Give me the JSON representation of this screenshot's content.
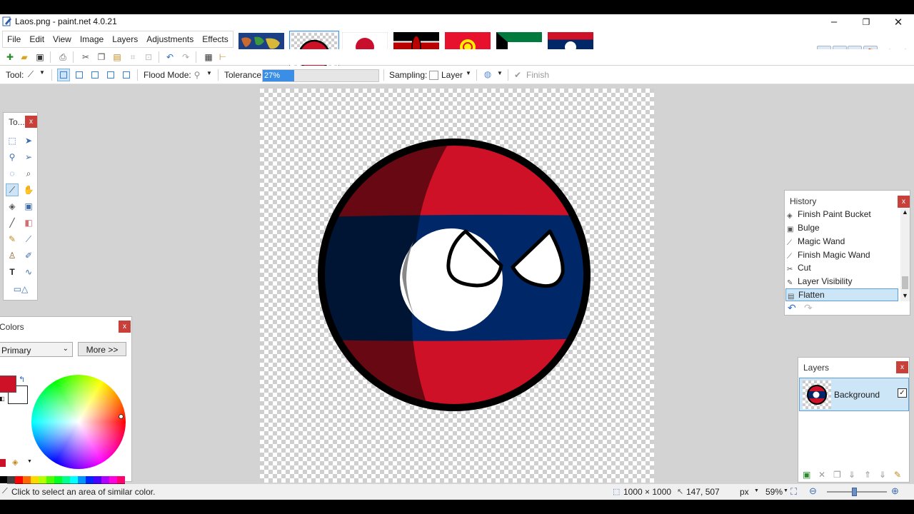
{
  "window": {
    "title": "Laos.png - paint.net 4.0.21"
  },
  "menu": [
    "File",
    "Edit",
    "View",
    "Image",
    "Layers",
    "Adjustments",
    "Effects"
  ],
  "image_strip": [
    {
      "name": "world-map",
      "active": false
    },
    {
      "name": "laos-ball",
      "active": true
    },
    {
      "name": "japan-flag",
      "active": false
    },
    {
      "name": "kenya-flag",
      "active": false
    },
    {
      "name": "kyrgyzstan-flag",
      "active": false
    },
    {
      "name": "kuwait-flag",
      "active": false
    },
    {
      "name": "laos-flag",
      "active": false
    }
  ],
  "toolbar": {
    "tool_label": "Tool:",
    "flood_mode_label": "Flood Mode:",
    "tolerance_label": "Tolerance:",
    "tolerance_value": "27%",
    "tolerance_fraction": 0.27,
    "sampling_label": "Sampling:",
    "sampling_value": "Layer",
    "finish_label": "Finish"
  },
  "tools_panel": {
    "title": "To...",
    "close": "x"
  },
  "colors_panel": {
    "title": "Colors",
    "close": "x",
    "mode": "Primary",
    "more_button": "More >>",
    "primary_color": "#ce1126",
    "secondary_color": "#ffffff",
    "palette": [
      "#000000",
      "#404040",
      "#ff0000",
      "#ff6a00",
      "#ffd800",
      "#b6ff00",
      "#4cff00",
      "#00ff21",
      "#00ff90",
      "#00ffff",
      "#0094ff",
      "#0026ff",
      "#4800ff",
      "#b200ff",
      "#ff00dc",
      "#ff006e",
      "#ffffff",
      "#808080",
      "#7f0000",
      "#7f3300",
      "#7f6a00",
      "#5b7f00",
      "#267f00",
      "#007f0e",
      "#007f46",
      "#007f7f",
      "#004a7f",
      "#00137f",
      "#21007f",
      "#57007f",
      "#7f006e",
      "#7f0037"
    ]
  },
  "history_panel": {
    "title": "History",
    "close": "x",
    "items": [
      {
        "label": "Finish Paint Bucket",
        "icon": "paint-bucket-icon"
      },
      {
        "label": "Bulge",
        "icon": "bulge-icon"
      },
      {
        "label": "Magic Wand",
        "icon": "magic-wand-icon"
      },
      {
        "label": "Finish Magic Wand",
        "icon": "magic-wand-icon"
      },
      {
        "label": "Cut",
        "icon": "scissors-icon"
      },
      {
        "label": "Layer Visibility",
        "icon": "layer-visibility-icon"
      },
      {
        "label": "Flatten",
        "icon": "flatten-icon",
        "selected": true
      }
    ]
  },
  "layers_panel": {
    "title": "Layers",
    "close": "x",
    "layers": [
      {
        "name": "Background",
        "visible": true
      }
    ]
  },
  "status": {
    "hint": "Click to select an area of similar color.",
    "image_size": "1000 × 1000",
    "cursor": "147, 507",
    "units": "px",
    "zoom": "59%"
  },
  "canvas_colors": {
    "red": "#ce1126",
    "blue": "#002868",
    "shade_red": "#671219",
    "shade_blue": "#001437",
    "white": "#ffffff",
    "outline": "#000000"
  }
}
